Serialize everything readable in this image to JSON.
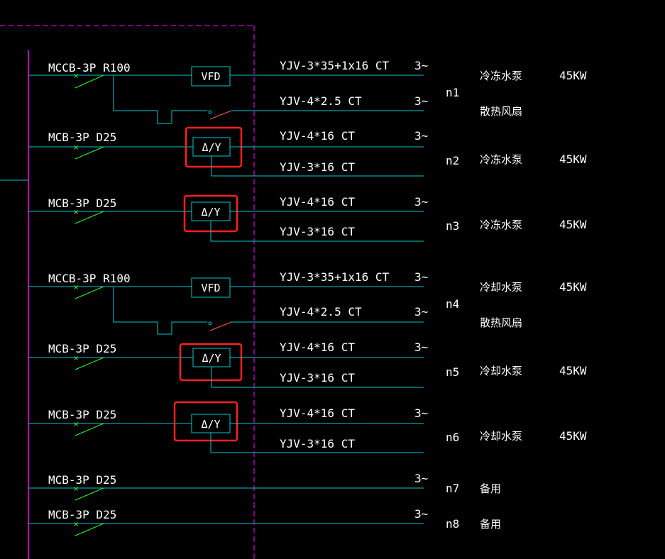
{
  "colors": {
    "background": "#000000",
    "wire": "#00c8c8",
    "breaker": "#30ff30",
    "border": "#ff00ff",
    "highlight": "#ff2020",
    "switch": "#ff6040",
    "text": "#ffffff"
  },
  "circuits": [
    {
      "breaker": "MCCB-3P R100",
      "device": "VFD",
      "circuit_no": "n1",
      "cables": [
        {
          "spec": "YJV-3*35+1x16  CT",
          "phase": "3~"
        },
        {
          "spec": "YJV-4*2.5  CT",
          "phase": "3~"
        }
      ],
      "loads": [
        {
          "name": "冷冻水泵",
          "power": "45KW"
        },
        {
          "name": "散热风扇",
          "power": ""
        }
      ]
    },
    {
      "breaker": "MCB-3P  D25",
      "device": "Δ/Y",
      "circuit_no": "n2",
      "cables": [
        {
          "spec": "YJV-4*16  CT",
          "phase": "3~"
        },
        {
          "spec": "YJV-3*16  CT",
          "phase": ""
        }
      ],
      "loads": [
        {
          "name": "冷冻水泵",
          "power": "45KW"
        }
      ]
    },
    {
      "breaker": "MCB-3P  D25",
      "device": "Δ/Y",
      "circuit_no": "n3",
      "cables": [
        {
          "spec": "YJV-4*16  CT",
          "phase": "3~"
        },
        {
          "spec": "YJV-3*16  CT",
          "phase": ""
        }
      ],
      "loads": [
        {
          "name": "冷冻水泵",
          "power": "45KW"
        }
      ]
    },
    {
      "breaker": "MCCB-3P R100",
      "device": "VFD",
      "circuit_no": "n4",
      "cables": [
        {
          "spec": "YJV-3*35+1x16  CT",
          "phase": "3~"
        },
        {
          "spec": "YJV-4*2.5  CT",
          "phase": "3~"
        }
      ],
      "loads": [
        {
          "name": "冷却水泵",
          "power": "45KW"
        },
        {
          "name": "散热风扇",
          "power": ""
        }
      ]
    },
    {
      "breaker": "MCB-3P  D25",
      "device": "Δ/Y",
      "circuit_no": "n5",
      "cables": [
        {
          "spec": "YJV-4*16  CT",
          "phase": "3~"
        },
        {
          "spec": "YJV-3*16  CT",
          "phase": ""
        }
      ],
      "loads": [
        {
          "name": "冷却水泵",
          "power": "45KW"
        }
      ]
    },
    {
      "breaker": "MCB-3P  D25",
      "device": "Δ/Y",
      "circuit_no": "n6",
      "cables": [
        {
          "spec": "YJV-4*16  CT",
          "phase": "3~"
        },
        {
          "spec": "YJV-3*16  CT",
          "phase": ""
        }
      ],
      "loads": [
        {
          "name": "冷却水泵",
          "power": "45KW"
        }
      ]
    },
    {
      "breaker": "MCB-3P  D25",
      "device": "",
      "circuit_no": "n7",
      "cables": [
        {
          "spec": "",
          "phase": "3~"
        }
      ],
      "loads": [
        {
          "name": "备用",
          "power": ""
        }
      ]
    },
    {
      "breaker": "MCB-3P  D25",
      "device": "",
      "circuit_no": "n8",
      "cables": [
        {
          "spec": "",
          "phase": "3~"
        }
      ],
      "loads": [
        {
          "name": "备用",
          "power": ""
        }
      ]
    }
  ]
}
